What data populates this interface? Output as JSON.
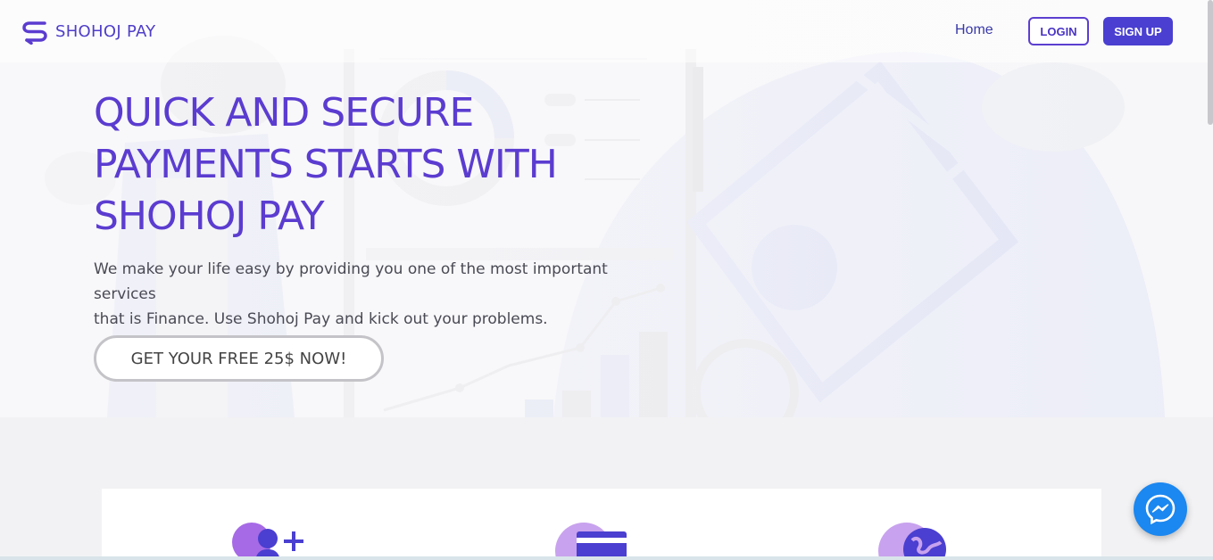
{
  "brand": {
    "name": "SHOHOJ PAY",
    "logo_icon": "s-logo-icon",
    "color": "#4f3ec8"
  },
  "nav": {
    "home_label": "Home",
    "login_label": "LOGIN",
    "signup_label": "SIGN UP"
  },
  "hero": {
    "title_lines": [
      "QUICK AND SECURE",
      "PAYMENTS STARTS WITH",
      "SHOHOJ PAY"
    ],
    "subtitle_lines": [
      "We make your life easy by providing you one of the most important services",
      "that is Finance. Use Shohoj Pay and kick out your problems."
    ],
    "cta_label": "GET YOUR FREE 25$ NOW!"
  },
  "features": {
    "icons": [
      "add-user-icon",
      "credit-card-icon",
      "globe-icon"
    ]
  },
  "chat": {
    "icon": "messenger-icon"
  },
  "colors": {
    "accent": "#5b3cd0",
    "signup_bg": "#4a3fd0",
    "messenger": "#1b87f0"
  }
}
